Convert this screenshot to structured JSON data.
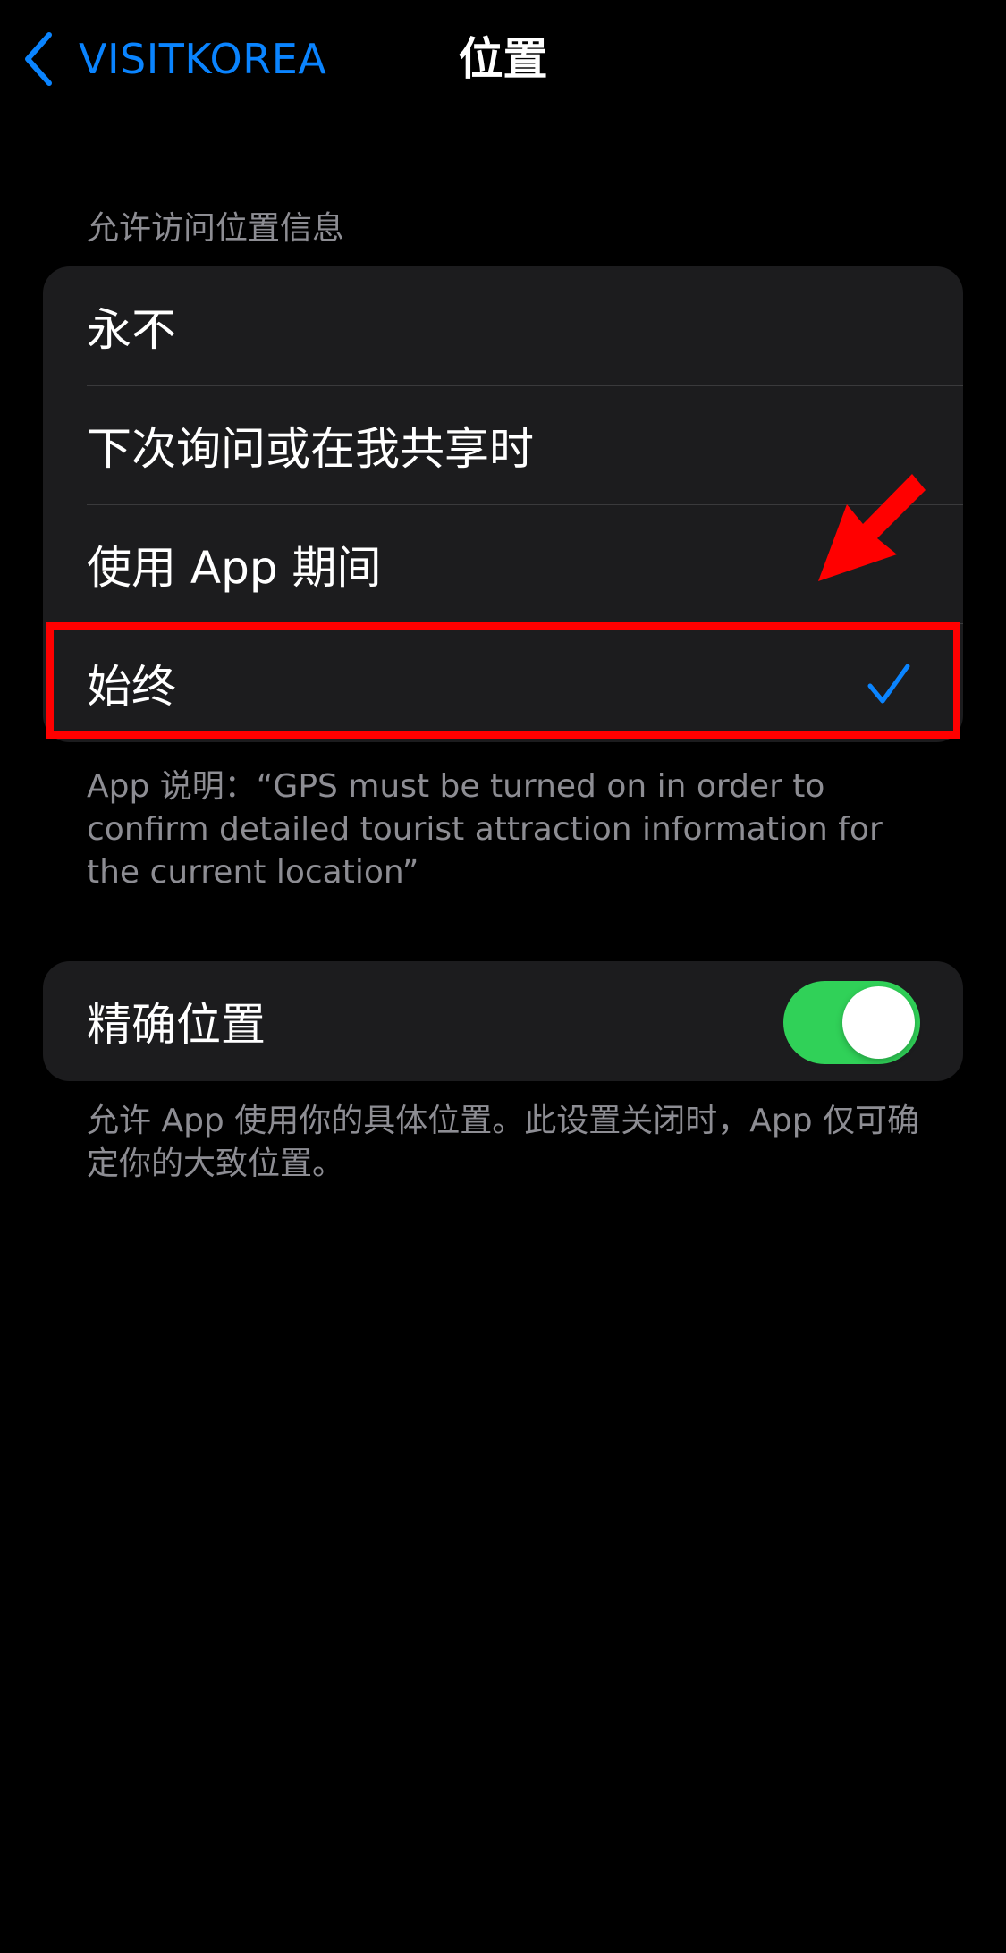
{
  "navbar": {
    "back_label": "VISITKOREA",
    "title": "位置"
  },
  "access_section": {
    "header": "允许访问位置信息",
    "options": [
      {
        "label": "永不",
        "selected": false
      },
      {
        "label": "下次询问或在我共享时",
        "selected": false
      },
      {
        "label": "使用 App 期间",
        "selected": false
      },
      {
        "label": "始终",
        "selected": true
      }
    ],
    "footer": "App 说明：“GPS must be turned on in order to confirm detailed tourist attraction information for the current location”"
  },
  "precise_section": {
    "label": "精确位置",
    "toggle_on": true,
    "footer": "允许 App 使用你的具体位置。此设置关闭时，App 仅可确定你的大致位置。"
  },
  "colors": {
    "background": "#000000",
    "cell_background": "#1c1c1e",
    "accent": "#0a84ff",
    "toggle_on": "#30d158",
    "annotation": "#ff0000",
    "secondary_text": "#8d8d93"
  },
  "icons": {
    "back": "chevron-left-icon",
    "selected": "checkmark-icon",
    "annotation": "red-arrow-icon"
  }
}
